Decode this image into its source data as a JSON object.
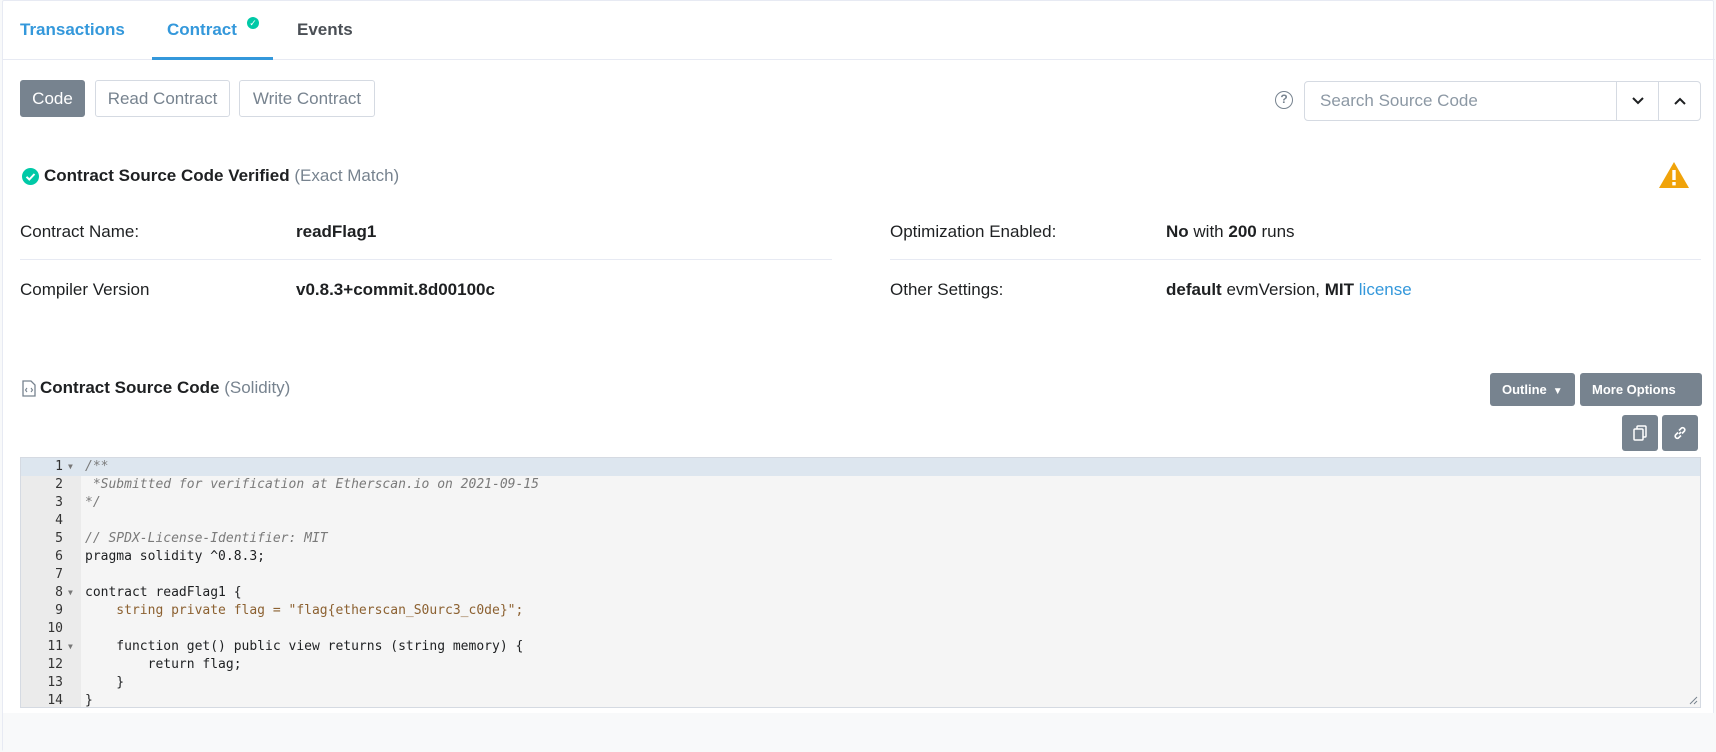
{
  "tabs": {
    "transactions": "Transactions",
    "contract": "Contract",
    "events": "Events"
  },
  "code_buttons": {
    "code": "Code",
    "read": "Read Contract",
    "write": "Write Contract"
  },
  "search": {
    "placeholder": "Search Source Code",
    "help": "?"
  },
  "verified": {
    "title": "Contract Source Code Verified",
    "match": "(Exact Match)"
  },
  "info": {
    "contract_name_label": "Contract Name:",
    "contract_name_value": "readFlag1",
    "compiler_label": "Compiler Version",
    "compiler_value": "v0.8.3+commit.8d00100c",
    "optimization_label": "Optimization Enabled:",
    "optimization_value": "No",
    "optimization_with": "with",
    "optimization_runs": "200",
    "optimization_runs_word": "runs",
    "other_label": "Other Settings:",
    "other_default": "default",
    "other_evm": "evmVersion,",
    "other_mit": "MIT",
    "other_license": "license"
  },
  "source": {
    "title": "Contract Source Code",
    "language": "(Solidity)",
    "outline_label": "Outline",
    "more_options_label": "More Options"
  },
  "code_lines": [
    "/**",
    " *Submitted for verification at Etherscan.io on 2021-09-15",
    "*/",
    "",
    "// SPDX-License-Identifier: MIT",
    "pragma solidity ^0.8.3;",
    "",
    "contract readFlag1 {",
    "    string private flag = \"flag{etherscan_S0urc3_c0de}\";",
    "",
    "    function get() public view returns (string memory) {",
    "        return flag;",
    "    }",
    "}"
  ],
  "line_numbers": [
    "1",
    "2",
    "3",
    "4",
    "5",
    "6",
    "7",
    "8",
    "9",
    "10",
    "11",
    "12",
    "13",
    "14"
  ],
  "colors": {
    "accent": "#3498db",
    "success": "#00c9a7",
    "warning": "#f0a30a",
    "button_gray": "#77838f"
  }
}
